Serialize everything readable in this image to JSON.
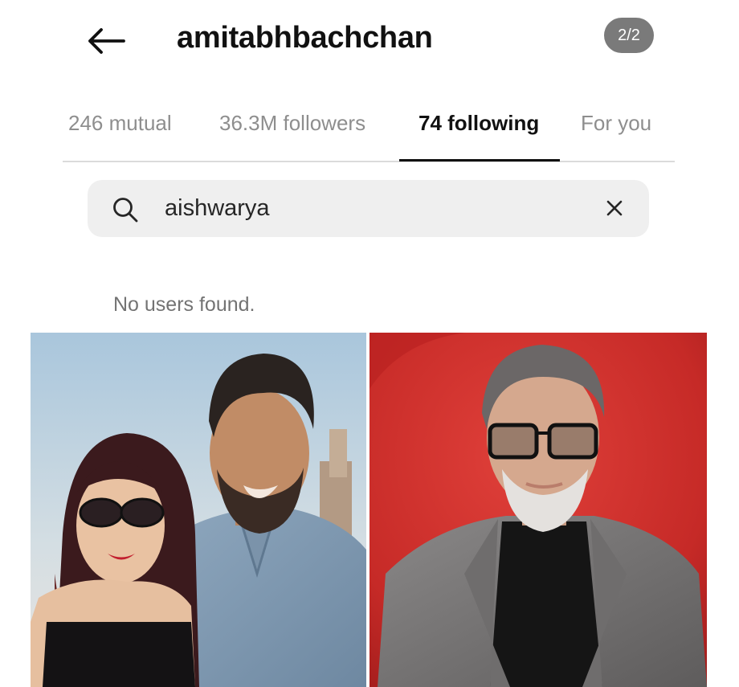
{
  "header": {
    "title": "amitabhbachchan",
    "page_indicator": "2/2",
    "back_icon": "arrow-left-icon"
  },
  "tabs": [
    {
      "label": "246 mutual",
      "active": false
    },
    {
      "label": "36.3M followers",
      "active": false
    },
    {
      "label": "74 following",
      "active": true
    },
    {
      "label": "For you",
      "active": false
    }
  ],
  "search": {
    "value": "aishwarya",
    "search_icon": "search-icon",
    "clear_icon": "close-icon"
  },
  "results": {
    "empty_message": "No users found."
  },
  "colors": {
    "active_tab": "#111111",
    "inactive_tab": "#8e8e8e",
    "search_bg": "#efefef",
    "badge_bg": "#7a7a7a",
    "right_photo_bg": "#c62a27"
  }
}
